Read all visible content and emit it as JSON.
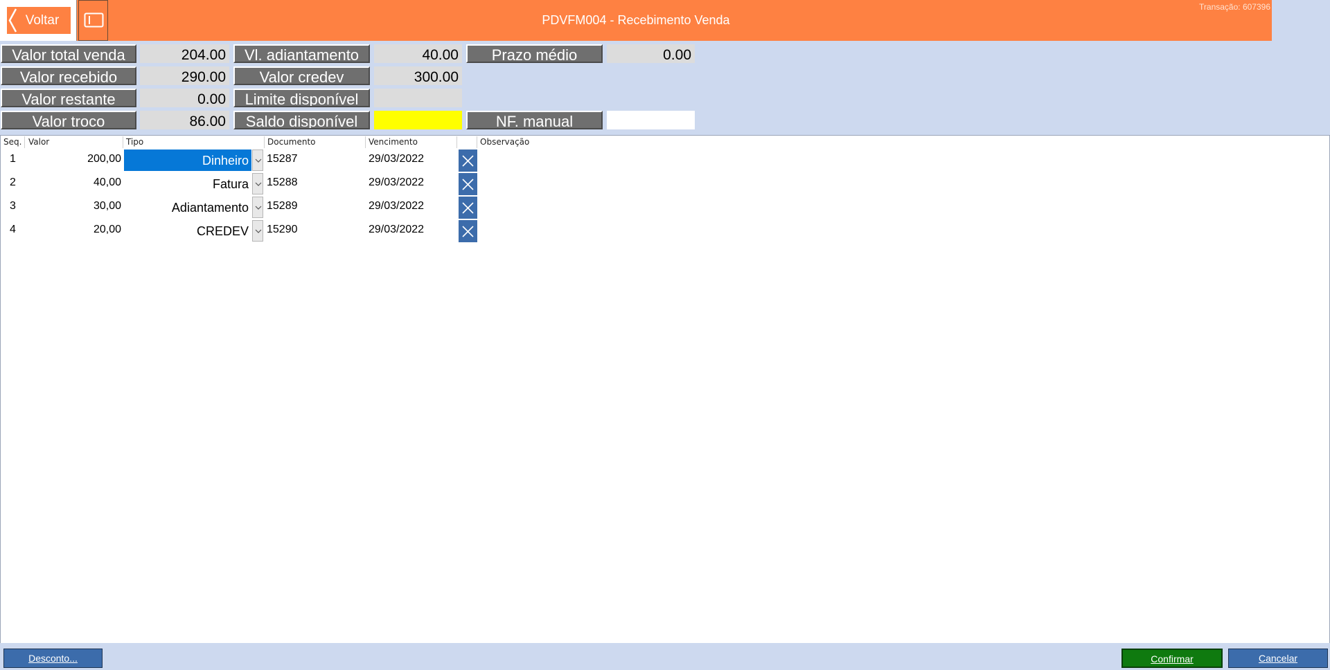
{
  "header": {
    "back_label": "Voltar",
    "title": "PDVFM004 - Recebimento Venda",
    "transaction": "Transação: 607396",
    "accent_color": "#fe8142"
  },
  "summary": {
    "valor_total_venda": {
      "label": "Valor total venda",
      "value": "204.00"
    },
    "valor_recebido": {
      "label": "Valor recebido",
      "value": "290.00"
    },
    "valor_restante": {
      "label": "Valor restante",
      "value": "0.00"
    },
    "valor_troco": {
      "label": "Valor troco",
      "value": "86.00"
    },
    "vl_adiantamento": {
      "label": "Vl. adiantamento",
      "value": "40.00"
    },
    "valor_credev": {
      "label": "Valor credev",
      "value": "300.00"
    },
    "limite_disponivel": {
      "label": "Limite disponível",
      "value": ""
    },
    "saldo_disponivel": {
      "label": "Saldo disponível",
      "value": ""
    },
    "prazo_medio": {
      "label": "Prazo médio",
      "value": "0.00"
    },
    "nf_manual": {
      "label": "NF. manual",
      "value": ""
    }
  },
  "grid": {
    "headers": {
      "seq": "Seq.",
      "valor": "Valor",
      "tipo": "Tipo",
      "documento": "Documento",
      "vencimento": "Vencimento",
      "observacao": "Observação"
    },
    "rows": [
      {
        "seq": "1",
        "valor": "200,00",
        "tipo": "Dinheiro",
        "documento": "15287",
        "vencimento": "29/03/2022",
        "observacao": ""
      },
      {
        "seq": "2",
        "valor": "40,00",
        "tipo": "Fatura",
        "documento": "15288",
        "vencimento": "29/03/2022",
        "observacao": ""
      },
      {
        "seq": "3",
        "valor": "30,00",
        "tipo": "Adiantamento",
        "documento": "15289",
        "vencimento": "29/03/2022",
        "observacao": ""
      },
      {
        "seq": "4",
        "valor": "20,00",
        "tipo": "CREDEV",
        "documento": "15290",
        "vencimento": "29/03/2022",
        "observacao": ""
      }
    ]
  },
  "footer": {
    "desconto": "Desconto...",
    "confirmar": "Confirmar",
    "cancelar": "Cancelar"
  },
  "icons": {
    "back": "chevron-left-icon",
    "panel": "panel-toggle-icon",
    "dropdown": "chevron-down-icon",
    "delete": "close-icon"
  }
}
